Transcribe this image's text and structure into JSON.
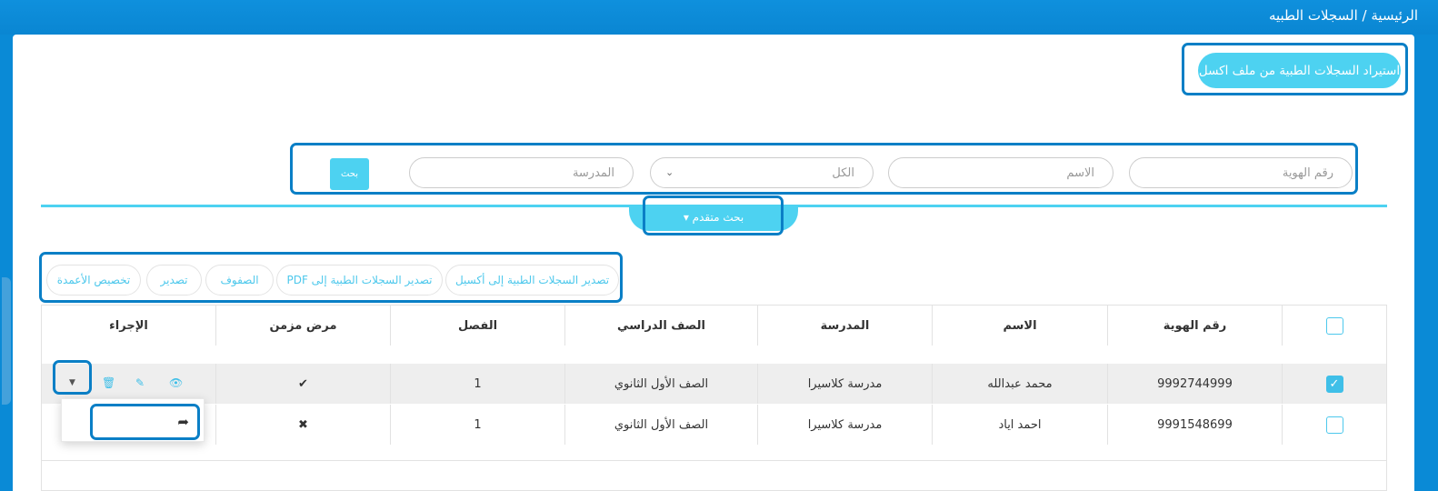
{
  "breadcrumb": "الرئيسية / السجلات الطبيه",
  "import_button": "استيراد السجلات الطبية من ملف اكسل",
  "search": {
    "id_placeholder": "رقم الهوية",
    "name_placeholder": "الاسم",
    "class_select_value": "الكل",
    "school_placeholder": "المدرسة",
    "search_button": "بحث",
    "advanced_label": "بحث متقدم ▾"
  },
  "toolbar": {
    "export_excel": "تصدير السجلات الطبية إلى أكسيل",
    "export_pdf": "تصدير السجلات الطبية إلى PDF",
    "rows": "الصفوف",
    "export": "تصدير",
    "customize_columns": "تخصيص الأعمدة"
  },
  "table": {
    "headers": {
      "id": "رقم الهوية",
      "name": "الاسم",
      "school": "المدرسة",
      "grade": "الصف الدراسي",
      "class": "الفصل",
      "chronic": "مرض مزمن",
      "action": "الإجراء"
    },
    "rows": [
      {
        "id": "9992744999",
        "name": "محمد عبدالله",
        "school": "مدرسة كلاسيرا",
        "grade": "الصف الأول الثانوي",
        "class": "1",
        "chronic": "✔",
        "checked": true
      },
      {
        "id": "9991548699",
        "name": "احمد اياد",
        "school": "مدرسة كلاسيرا",
        "grade": "الصف الأول الثانوي",
        "class": "1",
        "chronic": "✖",
        "checked": false
      }
    ]
  },
  "icons": {
    "view": "eye-icon",
    "edit": "pencil-icon",
    "delete": "trash-icon",
    "dropdown": "caret-down-icon",
    "forward": "share-arrow-icon"
  },
  "colors": {
    "header_blue": "#0a8ad6",
    "accent_cyan": "#4dd2f1",
    "highlight_border": "#0a7fc6"
  }
}
